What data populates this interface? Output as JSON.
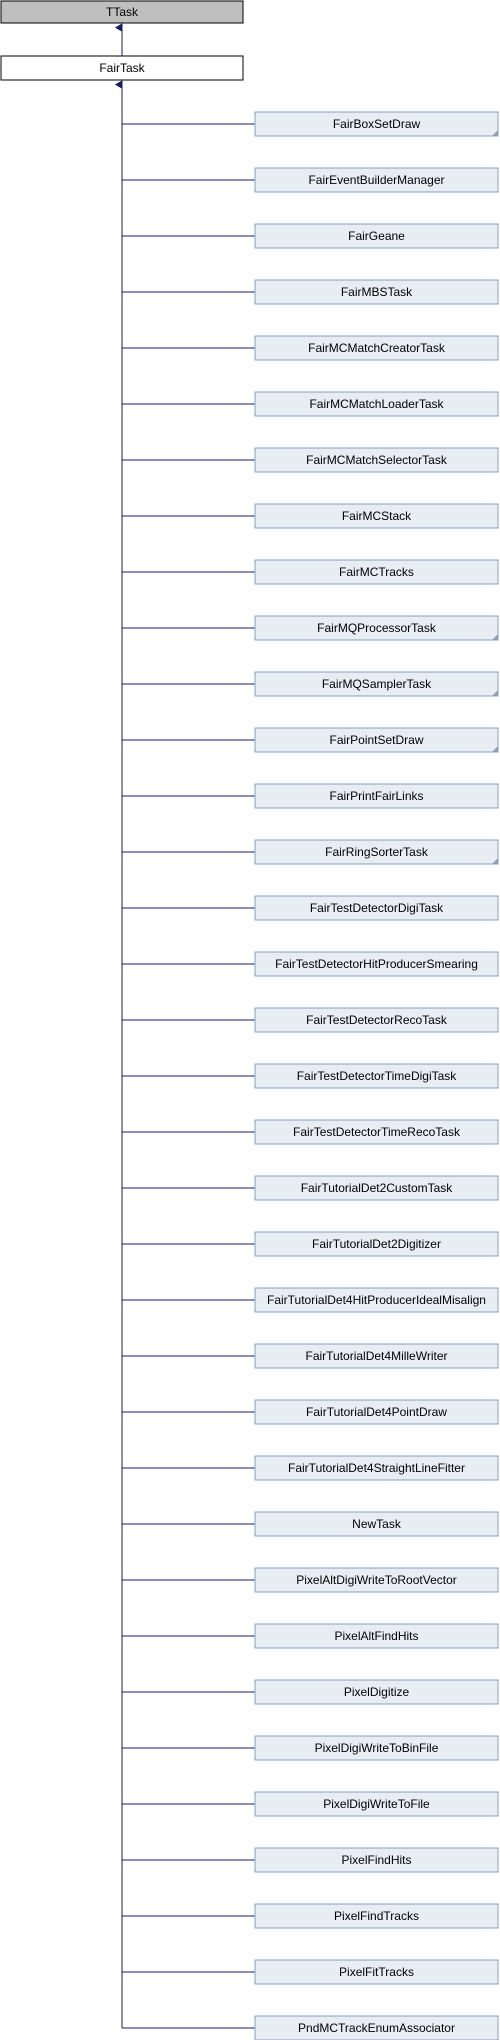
{
  "root": {
    "label": "TTask"
  },
  "parent": {
    "label": "FairTask"
  },
  "children": [
    {
      "label": "FairBoxSetDraw",
      "has_more": true
    },
    {
      "label": "FairEventBuilderManager",
      "has_more": false
    },
    {
      "label": "FairGeane",
      "has_more": false
    },
    {
      "label": "FairMBSTask",
      "has_more": false
    },
    {
      "label": "FairMCMatchCreatorTask",
      "has_more": false
    },
    {
      "label": "FairMCMatchLoaderTask",
      "has_more": false
    },
    {
      "label": "FairMCMatchSelectorTask",
      "has_more": false
    },
    {
      "label": "FairMCStack",
      "has_more": false
    },
    {
      "label": "FairMCTracks",
      "has_more": false
    },
    {
      "label": "FairMQProcessorTask",
      "has_more": true
    },
    {
      "label": "FairMQSamplerTask",
      "has_more": true
    },
    {
      "label": "FairPointSetDraw",
      "has_more": true
    },
    {
      "label": "FairPrintFairLinks",
      "has_more": false
    },
    {
      "label": "FairRingSorterTask",
      "has_more": true
    },
    {
      "label": "FairTestDetectorDigiTask",
      "has_more": false
    },
    {
      "label": "FairTestDetectorHitProducerSmearing",
      "has_more": false
    },
    {
      "label": "FairTestDetectorRecoTask",
      "has_more": false
    },
    {
      "label": "FairTestDetectorTimeDigiTask",
      "has_more": false
    },
    {
      "label": "FairTestDetectorTimeRecoTask",
      "has_more": false
    },
    {
      "label": "FairTutorialDet2CustomTask",
      "has_more": false
    },
    {
      "label": "FairTutorialDet2Digitizer",
      "has_more": false
    },
    {
      "label": "FairTutorialDet4HitProducerIdealMisalign",
      "has_more": false
    },
    {
      "label": "FairTutorialDet4MilleWriter",
      "has_more": false
    },
    {
      "label": "FairTutorialDet4PointDraw",
      "has_more": false
    },
    {
      "label": "FairTutorialDet4StraightLineFitter",
      "has_more": false
    },
    {
      "label": "NewTask",
      "has_more": false
    },
    {
      "label": "PixelAltDigiWriteToRootVector",
      "has_more": false
    },
    {
      "label": "PixelAltFindHits",
      "has_more": false
    },
    {
      "label": "PixelDigitize",
      "has_more": false
    },
    {
      "label": "PixelDigiWriteToBinFile",
      "has_more": false
    },
    {
      "label": "PixelDigiWriteToFile",
      "has_more": false
    },
    {
      "label": "PixelFindHits",
      "has_more": false
    },
    {
      "label": "PixelFindTracks",
      "has_more": false
    },
    {
      "label": "PixelFitTracks",
      "has_more": false
    },
    {
      "label": "PndMCTrackEnumAssociator",
      "has_more": false
    }
  ],
  "colors": {
    "root_fill": "#bfbfbf",
    "root_border": "#000000",
    "parent_fill": "#ffffff",
    "parent_border": "#000000",
    "child_fill": "#e8edf3",
    "child_border": "#84a0c0",
    "edge": "#191970",
    "more_marker": "#84a0c0"
  }
}
